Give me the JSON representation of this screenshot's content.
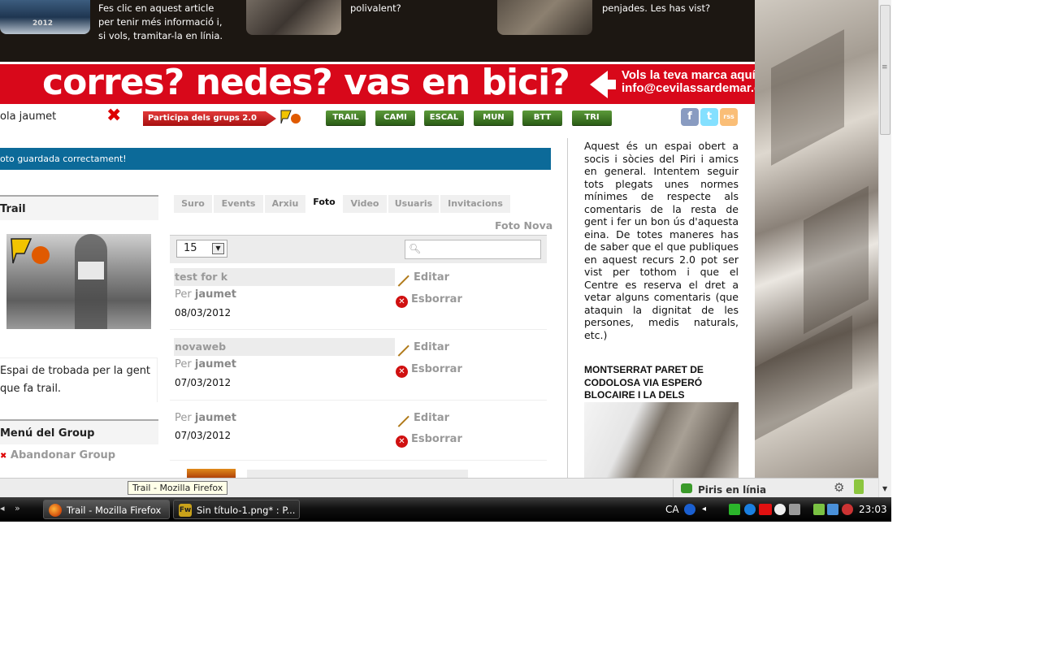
{
  "promo": {
    "article_text_1": "Fes clic en aquest article",
    "article_text_2": "per tenir més informació i,",
    "article_text_3": "si vols, tramitar-la en línia.",
    "middle_text": "polivalent?",
    "right_text": "penjades. Les has vist?",
    "badge_text": "2012"
  },
  "banner": {
    "slogan": "corres? nedes? vas en bici?",
    "cta_line1": "Vols la teva marca aquí?",
    "cta_line2": "info@cevilassardemar.cat"
  },
  "nav": {
    "greeting": "ola jaumet",
    "participa": "Participa dels grups 2.0",
    "groups": [
      "TRAIL",
      "CAMI",
      "ESCAL",
      "MUN",
      "BTT",
      "TRI"
    ],
    "social": [
      "f",
      "t",
      "rss"
    ]
  },
  "message": "oto guardada correctament!",
  "group": {
    "name": "Trail",
    "description_1": "Espai de trobada per la gent",
    "description_2": "que fa trail.",
    "menu_title": "Menú del Group",
    "menu_items": [
      "Abandonar Group"
    ]
  },
  "tabs": [
    "Suro",
    "Events",
    "Arxiu",
    "Foto",
    "Video",
    "Usuaris",
    "Invitacions"
  ],
  "active_tab": "Foto",
  "foto_nova": "Foto Nova",
  "per_page": "15",
  "search": {
    "placeholder": ""
  },
  "photos": [
    {
      "title": "test for k",
      "by_label": "Per",
      "author": "jaumet",
      "date": "08/03/2012",
      "edit": "Editar",
      "delete": "Esborrar"
    },
    {
      "title": "novaweb",
      "by_label": "Per",
      "author": "jaumet",
      "date": "07/03/2012",
      "edit": "Editar",
      "delete": "Esborrar"
    },
    {
      "title": "",
      "by_label": "Per",
      "author": "jaumet",
      "date": "07/03/2012",
      "edit": "Editar",
      "delete": "Esborrar"
    }
  ],
  "rules_text": "Aquest és un espai obert a socis i sòcies del Piri i amics en general. Intentem seguir tots plegats unes normes mínimes de respecte als comentaris de la resta de gent i fer un bon ús d'aquesta eina. De totes maneres has de saber que el que publiques en aquest recurs 2.0 pot ser vist per tothom i que el Centre es reserva el dret a vetar alguns comentaris (que ataquin la dignitat de les persones, medis naturals, etc.)",
  "article_title": "MONTSERRAT PARET DE CODOLOSA VIA ESPERÓ BLOCAIRE I LA DELS INDIGNATS",
  "statusbar": {
    "tooltip": "Trail - Mozilla Firefox",
    "chat": "Piris en línia"
  },
  "taskbar": {
    "windows": [
      "Trail - Mozilla Firefox",
      "Sin título-1.png* : P..."
    ],
    "lang": "CA",
    "clock": "23:03"
  },
  "colors": {
    "banner_red": "#d8081a",
    "message_blue": "#0c6a99",
    "group_green": "#3f7a24"
  }
}
